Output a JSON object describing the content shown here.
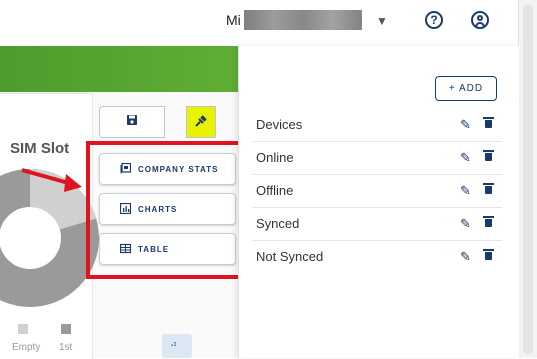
{
  "header": {
    "user_name_visible": "Mi",
    "help_icon": "help-circle-icon",
    "account_icon": "account-circle-icon"
  },
  "widget": {
    "title": "SIM Slot",
    "legend": [
      {
        "label": "Empty",
        "color": "#d0d0d0"
      },
      {
        "label": "1st",
        "color": "#9a9a9a"
      }
    ]
  },
  "toolbar": {
    "save_icon": "save-icon",
    "pin_icon": "pin-icon"
  },
  "add_menu": {
    "items": [
      {
        "label": "COMPANY STATS",
        "icon": "company-stats-icon"
      },
      {
        "label": "CHARTS",
        "icon": "charts-icon"
      },
      {
        "label": "TABLE",
        "icon": "table-icon"
      }
    ]
  },
  "stats_panel": {
    "add_label": "+ ADD",
    "items": [
      {
        "label": "Devices"
      },
      {
        "label": "Online"
      },
      {
        "label": "Offline"
      },
      {
        "label": "Synced"
      },
      {
        "label": "Not Synced"
      }
    ]
  },
  "colors": {
    "brand_green": "#5aa832",
    "accent_navy": "#1a3a6e",
    "highlight_red": "#e0141d",
    "pin_yellow": "#e8f300"
  }
}
